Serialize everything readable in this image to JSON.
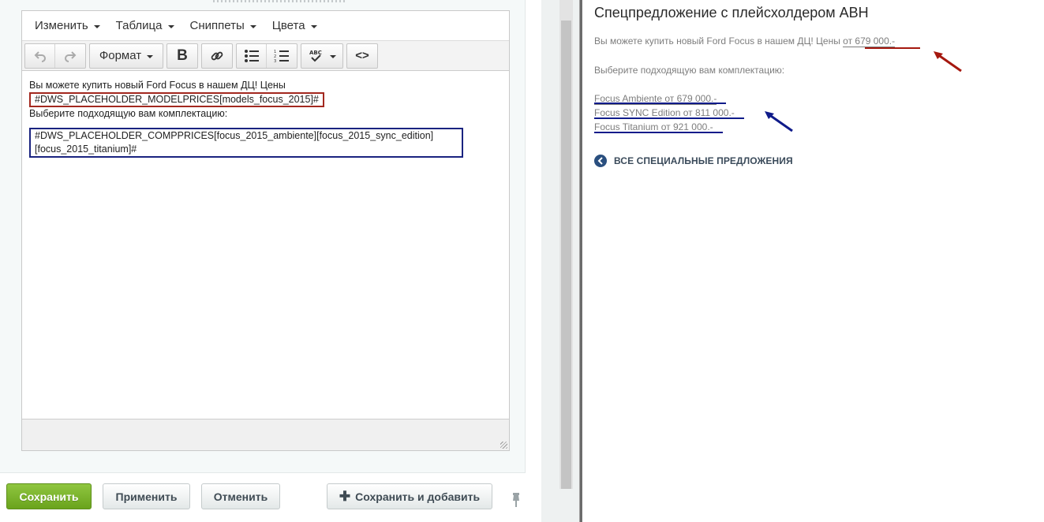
{
  "editor": {
    "menu": [
      {
        "label": "Изменить"
      },
      {
        "label": "Таблица"
      },
      {
        "label": "Сниппеты"
      },
      {
        "label": "Цвета"
      }
    ],
    "toolbar": {
      "format_label": "Формат",
      "bold_label": "B",
      "code_label": "<>"
    },
    "content": {
      "line1": "Вы можете купить новый Ford Focus в нашем ДЦ! Цены",
      "placeholder_model": "#DWS_PLACEHOLDER_MODELPRICES[models_focus_2015]#",
      "line3": "Выберите подходящую вам комплектацию:",
      "placeholder_comp_line1": "#DWS_PLACEHOLDER_COMPPRICES[focus_2015_ambiente][focus_2015_sync_edition]",
      "placeholder_comp_line2": "[focus_2015_titanium]#"
    },
    "highlight_colors": {
      "model": "#a3281f",
      "comp": "#1a2380"
    }
  },
  "buttons": {
    "save": "Сохранить",
    "apply": "Применить",
    "cancel": "Отменить",
    "save_add": "Сохранить и добавить"
  },
  "preview": {
    "title": "Спецпредложение с плейсхолдером АВН",
    "intro_prefix": "Вы можете купить новый Ford Focus в нашем ДЦ! Цены ",
    "intro_price": "от 679 000.-",
    "choose": "Выберите подходящую вам комплектацию:",
    "trims": [
      {
        "label": "Focus Ambiente от 679 000.-"
      },
      {
        "label": "Focus SYNC Edition от 811 000.-"
      },
      {
        "label": "Focus Titanium от 921 000.-"
      }
    ],
    "all_offers": "ВСЕ СПЕЦИАЛЬНЫЕ ПРЕДЛОЖЕНИЯ",
    "annotation_colors": {
      "red": "#a5180f",
      "blue": "#0f1b8a"
    }
  }
}
